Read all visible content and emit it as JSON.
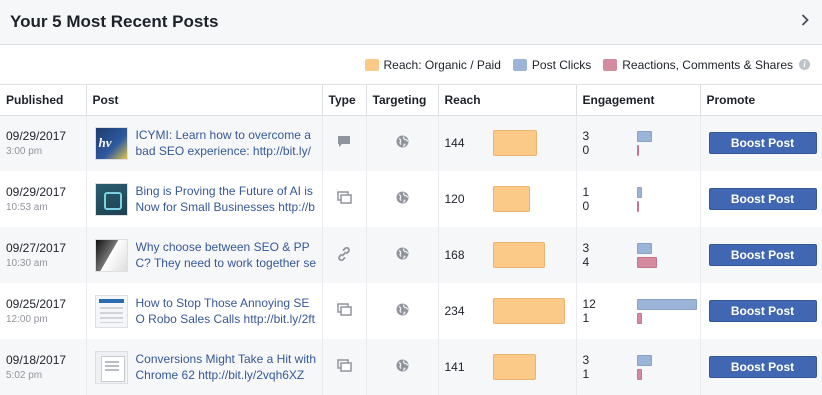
{
  "header": {
    "title": "Your 5 Most Recent Posts"
  },
  "legend": {
    "items": [
      {
        "label": "Reach: Organic / Paid",
        "color": "#fbc988"
      },
      {
        "label": "Post Clicks",
        "color": "#9cb4d8"
      },
      {
        "label": "Reactions, Comments & Shares",
        "color": "#d48a9f"
      }
    ]
  },
  "columns": [
    "Published",
    "Post",
    "Type",
    "Targeting",
    "Reach",
    "Engagement",
    "Promote"
  ],
  "rows": [
    {
      "date": "09/29/2017",
      "time": "3:00 pm",
      "post": "ICYMI: Learn how to overcome a bad SEO experience: http://bit.ly/",
      "type": "status-icon",
      "reach": "144",
      "reach_value": 144,
      "clicks": "3",
      "clicks_value": 3,
      "reactions": "0",
      "reactions_value": 0,
      "promote": "Boost Post"
    },
    {
      "date": "09/29/2017",
      "time": "10:53 am",
      "post": "Bing is Proving the Future of AI is Now for Small Businesses http://b",
      "type": "shared-icon",
      "reach": "120",
      "reach_value": 120,
      "clicks": "1",
      "clicks_value": 1,
      "reactions": "0",
      "reactions_value": 0,
      "promote": "Boost Post"
    },
    {
      "date": "09/27/2017",
      "time": "10:30 am",
      "post": "Why choose between SEO & PP C? They need to work together se",
      "type": "link-icon",
      "reach": "168",
      "reach_value": 168,
      "clicks": "3",
      "clicks_value": 3,
      "reactions": "4",
      "reactions_value": 4,
      "promote": "Boost Post"
    },
    {
      "date": "09/25/2017",
      "time": "12:00 pm",
      "post": "How to Stop Those Annoying SE O Robo Sales Calls http://bit.ly/2ft",
      "type": "shared-icon",
      "reach": "234",
      "reach_value": 234,
      "clicks": "12",
      "clicks_value": 12,
      "reactions": "1",
      "reactions_value": 1,
      "promote": "Boost Post"
    },
    {
      "date": "09/18/2017",
      "time": "5:02 pm",
      "post": "Conversions Might Take a Hit with Chrome 62 http://bit.ly/2vqh6XZ",
      "type": "shared-icon",
      "reach": "141",
      "reach_value": 141,
      "clicks": "3",
      "clicks_value": 3,
      "reactions": "1",
      "reactions_value": 1,
      "promote": "Boost Post"
    }
  ]
}
